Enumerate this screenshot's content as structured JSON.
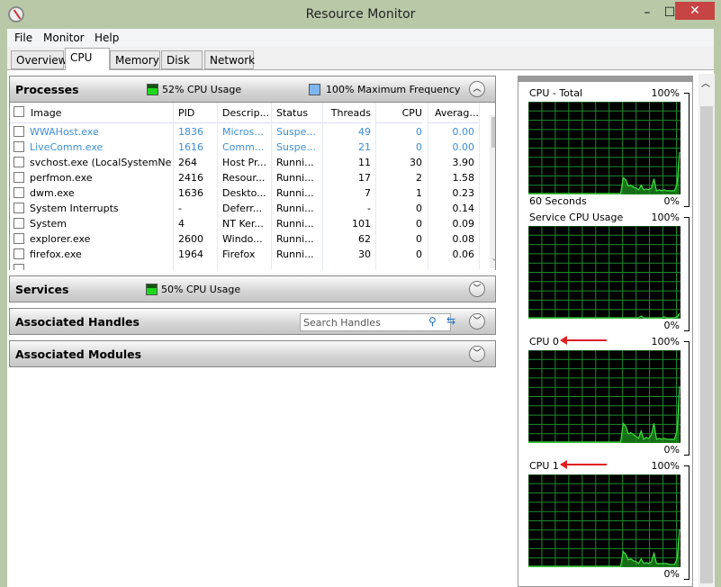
{
  "window": {
    "title": "Resource Monitor",
    "minimize": "–",
    "maximize": "☐",
    "close": "✕",
    "close_color": "#c74444"
  },
  "menu": [
    "File",
    "Monitor",
    "Help"
  ],
  "tabs": [
    {
      "label": "Overview"
    },
    {
      "label": "CPU",
      "active": true
    },
    {
      "label": "Memory"
    },
    {
      "label": "Disk"
    },
    {
      "label": "Network"
    }
  ],
  "processes": {
    "title": "Processes",
    "cpu_usage": "52% CPU Usage",
    "max_freq": "100% Maximum Frequency",
    "columns": [
      "Image",
      "PID",
      "Descrip...",
      "Status",
      "Threads",
      "CPU",
      "Averag..."
    ],
    "rows": [
      [
        "WWAHost.exe",
        "1836",
        "Micros...",
        "Suspe...",
        "49",
        "0",
        "0.00"
      ],
      [
        "LiveComm.exe",
        "1616",
        "Comm...",
        "Suspe...",
        "21",
        "0",
        "0.00"
      ],
      [
        "svchost.exe (LocalSystemNet...",
        "264",
        "Host Pr...",
        "Runni...",
        "11",
        "30",
        "3.90"
      ],
      [
        "perfmon.exe",
        "2416",
        "Resour...",
        "Runni...",
        "17",
        "2",
        "1.58"
      ],
      [
        "dwm.exe",
        "1636",
        "Deskto...",
        "Runni...",
        "7",
        "1",
        "0.23"
      ],
      [
        "System Interrupts",
        "-",
        "Deferr...",
        "Runni...",
        "-",
        "0",
        "0.14"
      ],
      [
        "System",
        "4",
        "NT Ker...",
        "Runni...",
        "101",
        "0",
        "0.09"
      ],
      [
        "explorer.exe",
        "2600",
        "Windo...",
        "Runni...",
        "62",
        "0",
        "0.08"
      ],
      [
        "firefox.exe",
        "1964",
        "Firefox",
        "Runni...",
        "30",
        "0",
        "0.06"
      ]
    ],
    "suspended_color": "#3c8fd6"
  },
  "services": {
    "title": "Services",
    "cpu_usage": "50% CPU Usage"
  },
  "handles": {
    "title": "Associated Handles",
    "search_placeholder": "Search Handles"
  },
  "modules": {
    "title": "Associated Modules"
  },
  "graphs": [
    {
      "label": "CPU - Total",
      "max": "100%",
      "min": "0%",
      "time": "60 Seconds",
      "values": [
        0,
        0,
        0,
        0,
        0,
        0,
        0,
        0,
        0,
        0,
        0,
        0,
        0,
        0,
        0,
        0,
        0,
        0,
        0,
        0,
        0,
        0,
        0,
        0,
        0,
        0,
        0,
        0,
        0,
        0,
        0,
        0,
        0,
        0,
        0,
        0,
        0,
        0,
        0,
        0,
        0,
        0,
        0,
        0,
        0,
        0,
        0,
        0,
        0,
        0,
        0,
        0,
        0,
        0,
        0,
        0,
        0,
        0,
        0,
        0,
        0,
        0,
        0,
        0,
        0,
        0,
        0,
        0,
        0,
        0,
        0,
        0,
        0,
        0,
        0,
        0,
        0,
        0,
        0,
        0,
        0,
        0,
        0,
        0,
        0,
        0,
        0,
        0,
        0,
        0,
        0,
        0,
        0,
        0,
        0,
        0,
        0,
        0,
        0,
        0
      ]
    },
    {
      "label": "Service CPU Usage",
      "max": "100%",
      "min": "0%"
    },
    {
      "label": "CPU 0",
      "max": "100%",
      "min": "0%",
      "annotated": true
    },
    {
      "label": "CPU 1",
      "max": "100%",
      "min": "0%",
      "annotated": true
    }
  ],
  "graph_series": {
    "total": [
      0,
      0,
      0,
      0,
      0,
      0,
      0,
      0,
      0,
      0,
      0,
      0,
      0,
      0,
      0,
      0,
      0,
      0,
      0,
      0,
      0,
      0,
      0,
      0,
      0,
      0,
      0,
      0,
      0,
      0,
      0,
      0,
      0,
      0,
      0,
      0,
      0,
      17,
      15,
      8,
      9,
      7,
      6,
      4,
      9,
      4,
      5,
      4,
      6,
      16,
      3,
      4,
      3,
      4,
      3,
      3,
      3,
      3,
      10,
      45
    ],
    "service": [
      0,
      0,
      0,
      0,
      0,
      0,
      0,
      0,
      0,
      0,
      0,
      0,
      0,
      0,
      0,
      0,
      0,
      0,
      0,
      0,
      0,
      0,
      0,
      0,
      0,
      0,
      0,
      0,
      0,
      0,
      0,
      0,
      0,
      0,
      0,
      0,
      0,
      0,
      0,
      0,
      0,
      0,
      0,
      0,
      2,
      0,
      0,
      0,
      0,
      0,
      0,
      0,
      0,
      1,
      0,
      0,
      0,
      0,
      1,
      5
    ],
    "cpu0": [
      0,
      0,
      0,
      0,
      0,
      0,
      0,
      0,
      0,
      0,
      0,
      0,
      0,
      0,
      0,
      0,
      0,
      0,
      0,
      0,
      0,
      0,
      0,
      0,
      0,
      0,
      0,
      0,
      0,
      0,
      0,
      0,
      0,
      0,
      0,
      0,
      0,
      20,
      17,
      9,
      10,
      8,
      6,
      4,
      12,
      3,
      5,
      4,
      8,
      20,
      3,
      4,
      3,
      4,
      3,
      3,
      3,
      3,
      12,
      60
    ],
    "cpu1": [
      0,
      0,
      0,
      0,
      0,
      0,
      0,
      0,
      0,
      0,
      0,
      0,
      0,
      0,
      0,
      0,
      0,
      0,
      0,
      0,
      0,
      0,
      0,
      0,
      0,
      0,
      0,
      0,
      0,
      0,
      0,
      0,
      0,
      0,
      0,
      0,
      0,
      16,
      13,
      7,
      8,
      6,
      5,
      3,
      8,
      3,
      4,
      3,
      5,
      14,
      3,
      3,
      3,
      3,
      3,
      2,
      2,
      2,
      8,
      40
    ]
  },
  "colors": {
    "graph_bg": "#000000",
    "graph_grid": "#1f8a2e",
    "graph_line": "#3fe03f",
    "arrow": "#e02020"
  }
}
